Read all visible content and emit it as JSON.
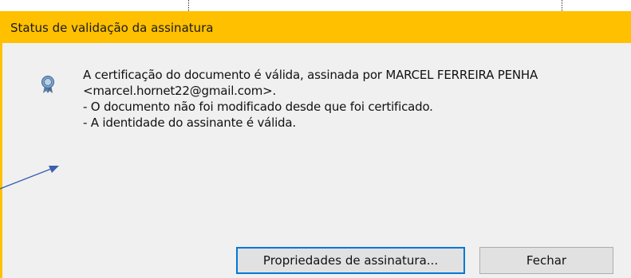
{
  "dialog": {
    "title": "Status de validação da assinatura",
    "icon": "certificate-seal-icon",
    "message_lines": [
      "A certificação do documento é válida, assinada por MARCEL FERREIRA PENHA",
      "<marcel.hornet22@gmail.com>.",
      "- O documento não foi modificado desde que foi certificado.",
      "- A identidade do assinante é válida."
    ],
    "buttons": {
      "properties_label": "Propriedades de assinatura...",
      "close_label": "Fechar"
    }
  },
  "colors": {
    "titlebar": "#ffc000",
    "body": "#f0f0f0",
    "default_button_border": "#0078d7",
    "annotation_arrow": "#3a5fb0"
  }
}
